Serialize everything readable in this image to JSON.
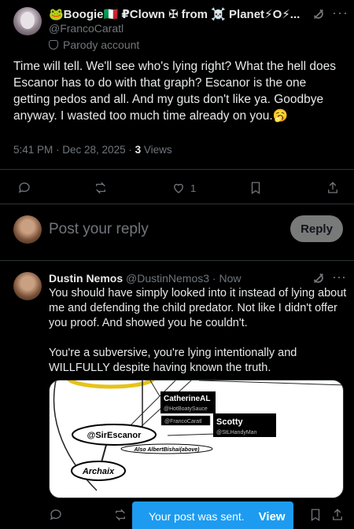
{
  "post": {
    "display_name": "🐸Boogie🇮🇹 ₽Clown ✠ from ☠️ Planet⚡O⚡...",
    "handle": "@FrancoCaratl",
    "parody_label": "Parody account",
    "text": "Time will tell. We'll see who's lying right? What the hell does Escanor has to do with that graph? Escanor is the one getting pedos and all. And my guts don't like ya. Goodbye anyway. I wasted too much time already on you.🥱",
    "timestamp": "5:41 PM · Dec 28, 2025 · ",
    "views_count": "3",
    "views_label": " Views",
    "like_count": "1"
  },
  "composer": {
    "placeholder": "Post your reply",
    "reply_button": "Reply"
  },
  "reply": {
    "display_name": "Dustin Nemos",
    "handle": "@DustinNemos3",
    "time": " · Now",
    "text_p1": "You should have simply looked into it instead of lying about me and defending the child predator. Not like I didn't offer you proof. And showed you he couldn't.",
    "text_p2": "You're a subversive, you're lying intentionally and WILLFULLY despite having known the truth.",
    "media": {
      "label_catherine": "CatherineAL",
      "label_hotboaty": "@HotBoatySauce",
      "label_franco": "@FrancoCaratl",
      "label_scotty": "Scotty",
      "label_stl": "@StLHandyMan",
      "label_escanor": "@SirEscanor",
      "label_also": "Also AlbertBishai(above)",
      "label_archaix": "Archaix"
    }
  },
  "toast": {
    "message": "Your post was sent.",
    "action": "View"
  },
  "colors": {
    "accent": "#1d9bf0",
    "muted": "#71767b",
    "text": "#e7e9ea",
    "background": "#000000"
  }
}
